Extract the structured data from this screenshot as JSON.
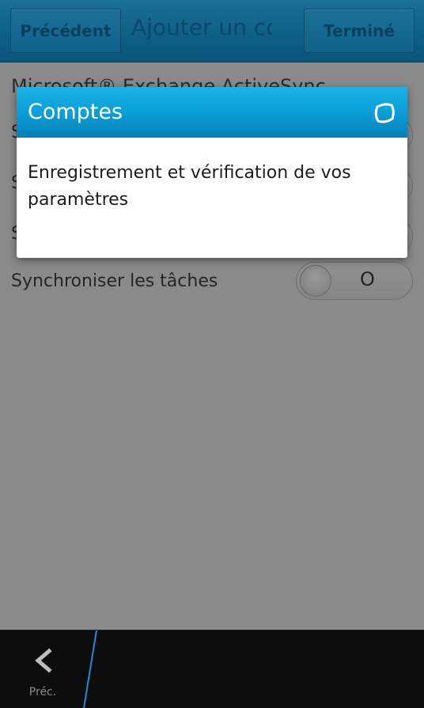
{
  "titlebar": {
    "prev_label": "Précédent",
    "title": "Ajouter un co",
    "done_label": "Terminé"
  },
  "content": {
    "exchange_heading": "Microsoft® Exchange ActiveSync",
    "rows": [
      {
        "label": "S",
        "toggle": ""
      },
      {
        "label": "S",
        "toggle": ""
      },
      {
        "label": "S",
        "toggle": ""
      },
      {
        "label": "Synchroniser les tâches",
        "toggle": "O"
      }
    ]
  },
  "actionbar": {
    "back_label": "Préc.",
    "back_icon": "chevron-left-icon"
  },
  "dialog": {
    "title": "Comptes",
    "message": "Enregistrement et vérification de vos paramètres",
    "spinner_icon": "activity-spinner-icon"
  },
  "colors": {
    "dialog_header": "#0a9fd8",
    "overlay_background": "#8a8a8a",
    "titlebar": "#0e5f84",
    "actionbar": "#0c0c0c"
  }
}
